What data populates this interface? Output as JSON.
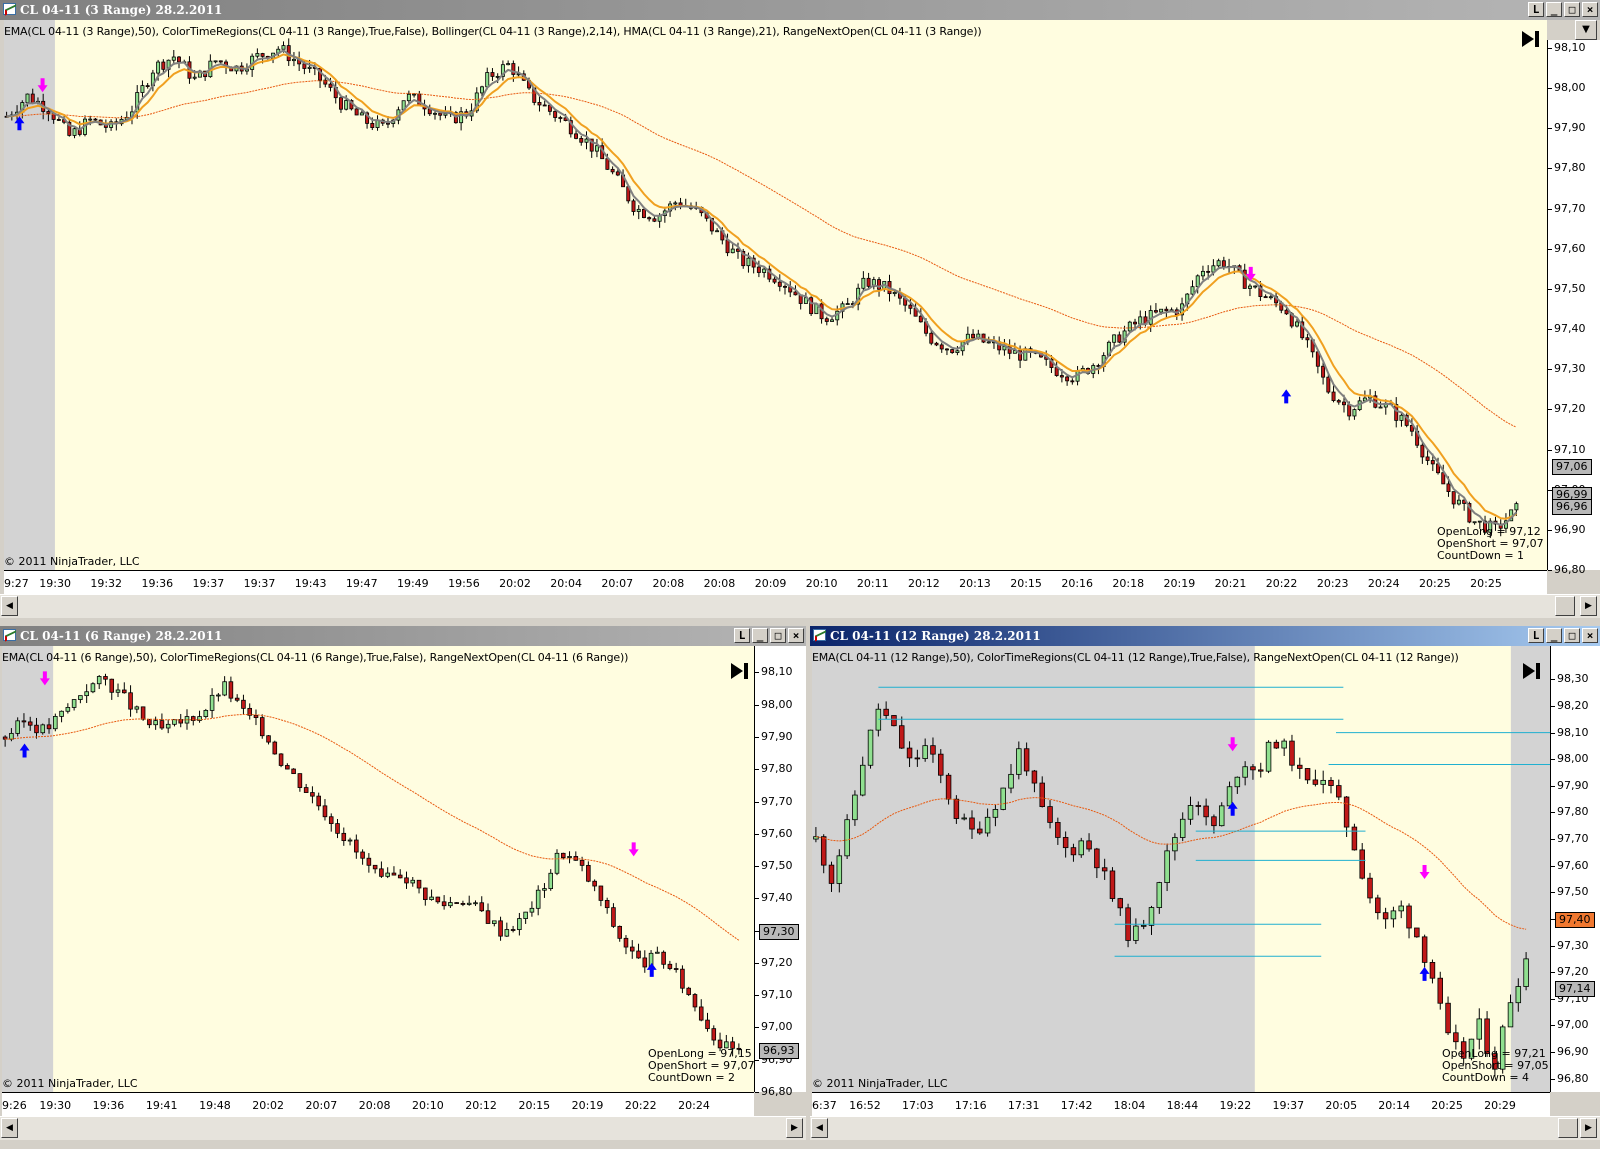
{
  "colors": {
    "background": "#fffde0",
    "session_shade": "#d3d3d3",
    "bull": "#90e090",
    "bear": "#c01818",
    "ema": "#e85a10",
    "bollinger": "#808080",
    "hma": "#f0a020",
    "range_line": "#20b0d0",
    "buy_arrow": "#0000ff",
    "sell_arrow": "#ff00ff"
  },
  "copyright": "© 2011 NinjaTrader, LLC",
  "top_chart": {
    "title": "CL 04-11 (3 Range)  28.2.2011",
    "indicators": "EMA(CL 04-11 (3 Range),50), ColorTimeRegions(CL 04-11 (3 Range),True,False), Bollinger(CL 04-11 (3 Range),2,14), HMA(CL 04-11 (3 Range),21), RangeNextOpen(CL 04-11 (3 Range))",
    "price_ticks": [
      "98,10",
      "98,00",
      "97,90",
      "97,80",
      "97,70",
      "97,60",
      "97,50",
      "97,40",
      "97,30",
      "97,20",
      "97,10",
      "97,00",
      "96,90",
      "96,80"
    ],
    "time_ticks": [
      "9:27",
      "19:30",
      "19:32",
      "19:36",
      "19:37",
      "19:37",
      "19:43",
      "19:47",
      "19:49",
      "19:56",
      "20:02",
      "20:04",
      "20:07",
      "20:08",
      "20:08",
      "20:09",
      "20:10",
      "20:11",
      "20:12",
      "20:13",
      "20:15",
      "20:16",
      "20:18",
      "20:19",
      "20:21",
      "20:22",
      "20:23",
      "20:24",
      "20:25",
      "20:25"
    ],
    "price_tags": [
      "97,06",
      "96,99",
      "96,96"
    ],
    "stats": [
      "OpenLong = 97,12",
      "OpenShort = 97,07",
      "CountDown = 1"
    ],
    "chart_data": {
      "type": "candlestick",
      "ylim": [
        96.8,
        98.12
      ],
      "price_path": [
        97.93,
        97.98,
        97.95,
        97.88,
        97.92,
        97.9,
        97.95,
        98.05,
        98.08,
        98.02,
        98.07,
        98.05,
        98.08,
        98.1,
        98.06,
        98.02,
        97.96,
        97.92,
        97.9,
        97.98,
        97.96,
        97.92,
        97.94,
        98.03,
        98.06,
        97.98,
        97.94,
        97.9,
        97.85,
        97.78,
        97.7,
        97.68,
        97.72,
        97.69,
        97.63,
        97.57,
        97.55,
        97.52,
        97.47,
        97.43,
        97.45,
        97.52,
        97.5,
        97.45,
        97.38,
        97.35,
        97.38,
        97.36,
        97.34,
        97.33,
        97.3,
        97.28,
        97.32,
        97.38,
        97.42,
        97.44,
        97.45,
        97.55,
        97.57,
        97.52,
        97.48,
        97.45,
        97.36,
        97.25,
        97.2,
        97.23,
        97.2,
        97.15,
        97.05,
        96.98,
        96.92,
        96.9,
        96.95
      ]
    }
  },
  "left_chart": {
    "title": "CL 04-11 (6 Range)  28.2.2011",
    "indicators": "EMA(CL 04-11 (6 Range),50), ColorTimeRegions(CL 04-11 (6 Range),True,False), RangeNextOpen(CL 04-11 (6 Range))",
    "price_ticks": [
      "98,10",
      "98,00",
      "97,90",
      "97,80",
      "97,70",
      "97,60",
      "97,50",
      "97,40",
      "97,30",
      "97,20",
      "97,10",
      "97,00",
      "96,90",
      "96,80"
    ],
    "time_ticks": [
      "9:26",
      "19:30",
      "19:36",
      "19:41",
      "19:48",
      "20:02",
      "20:07",
      "20:08",
      "20:10",
      "20:12",
      "20:15",
      "20:19",
      "20:22",
      "20:24"
    ],
    "price_tags": [
      "97,30",
      "96,93"
    ],
    "stats": [
      "OpenLong = 97,15",
      "OpenShort = 97,07",
      "CountDown = 2"
    ],
    "chart_data": {
      "type": "candlestick",
      "ylim": [
        96.8,
        98.12
      ],
      "price_path": [
        97.9,
        97.95,
        97.92,
        97.98,
        98.05,
        98.08,
        98.02,
        97.95,
        97.92,
        97.95,
        97.98,
        98.06,
        97.98,
        97.92,
        97.82,
        97.75,
        97.68,
        97.6,
        97.52,
        97.45,
        97.48,
        97.42,
        97.38,
        97.4,
        97.36,
        97.3,
        97.33,
        97.42,
        97.55,
        97.5,
        97.4,
        97.28,
        97.2,
        97.22,
        97.15,
        97.05,
        96.95,
        96.92
      ]
    }
  },
  "right_chart": {
    "title": "CL 04-11 (12 Range)  28.2.2011",
    "indicators": "EMA(CL 04-11 (12 Range),50), ColorTimeRegions(CL 04-11 (12 Range),True,False), RangeNextOpen(CL 04-11 (12 Range))",
    "price_ticks": [
      "98,30",
      "98,20",
      "98,10",
      "98,00",
      "97,90",
      "97,80",
      "97,70",
      "97,60",
      "97,50",
      "97,40",
      "97,30",
      "97,20",
      "97,10",
      "97,00",
      "96,90",
      "96,80"
    ],
    "time_ticks": [
      "6:37",
      "16:52",
      "17:03",
      "17:16",
      "17:31",
      "17:42",
      "18:04",
      "18:44",
      "19:22",
      "19:37",
      "20:05",
      "20:14",
      "20:25",
      "20:29"
    ],
    "price_tags": [
      "97,40",
      "97,14"
    ],
    "stats": [
      "OpenLong = 97,21",
      "OpenShort = 97,05",
      "CountDown = 4"
    ],
    "chart_data": {
      "type": "candlestick",
      "ylim": [
        96.75,
        98.35
      ],
      "price_path": [
        97.7,
        97.55,
        97.75,
        98.0,
        98.2,
        98.1,
        97.98,
        98.05,
        97.92,
        97.78,
        97.72,
        97.8,
        97.9,
        98.05,
        97.85,
        97.72,
        97.65,
        97.7,
        97.6,
        97.45,
        97.32,
        97.42,
        97.6,
        97.75,
        97.88,
        97.72,
        97.85,
        98.0,
        97.95,
        98.08,
        98.02,
        97.9,
        97.95,
        97.85,
        97.7,
        97.5,
        97.38,
        97.45,
        97.35,
        97.2,
        96.95,
        96.88,
        97.0,
        96.85,
        97.1,
        97.25
      ]
    }
  }
}
